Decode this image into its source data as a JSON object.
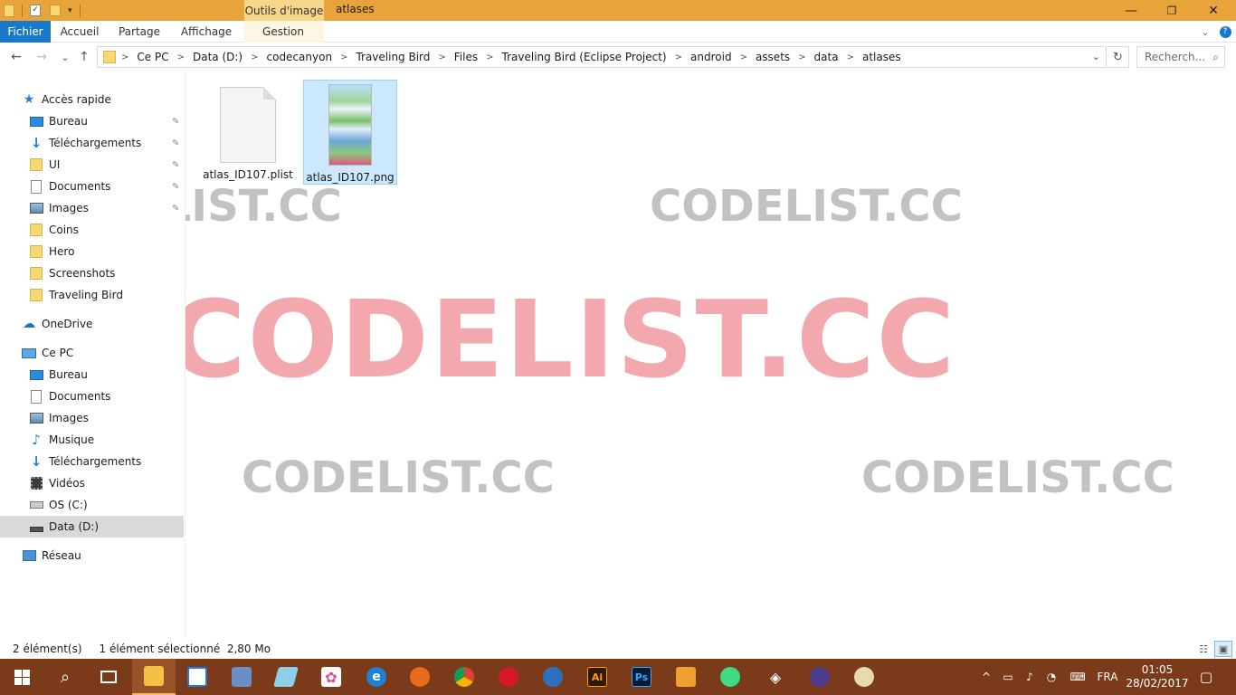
{
  "titlebar": {
    "context_tab": "Outils d'image",
    "title": "atlases",
    "minimize": "—",
    "restore": "❐",
    "close": "✕"
  },
  "ribbon": {
    "file": "Fichier",
    "home": "Accueil",
    "share": "Partage",
    "view": "Affichage",
    "manage": "Gestion"
  },
  "nav": {
    "back": "←",
    "forward": "→",
    "recent": "⌄",
    "up": "↑",
    "breadcrumb": [
      "Ce PC",
      "Data (D:)",
      "codecanyon",
      "Traveling Bird",
      "Files",
      "Traveling Bird (Eclipse Project)",
      "android",
      "assets",
      "data",
      "atlases"
    ],
    "search_placeholder": "Recherch...",
    "refresh": "↻"
  },
  "sidebar": {
    "quick_access": "Accès rapide",
    "quick_items": [
      {
        "label": "Bureau",
        "icon": "desktop-icon",
        "pinned": true
      },
      {
        "label": "Téléchargements",
        "icon": "download-icon",
        "pinned": true
      },
      {
        "label": "UI",
        "icon": "folder-icon",
        "pinned": true
      },
      {
        "label": "Documents",
        "icon": "documents-icon",
        "pinned": true
      },
      {
        "label": "Images",
        "icon": "images-icon",
        "pinned": true
      },
      {
        "label": "Coins",
        "icon": "folder-icon",
        "pinned": false
      },
      {
        "label": "Hero",
        "icon": "folder-icon",
        "pinned": false
      },
      {
        "label": "Screenshots",
        "icon": "folder-icon",
        "pinned": false
      },
      {
        "label": "Traveling Bird",
        "icon": "folder-icon",
        "pinned": false
      }
    ],
    "onedrive": "OneDrive",
    "this_pc": "Ce PC",
    "pc_items": [
      {
        "label": "Bureau",
        "icon": "desktop-icon"
      },
      {
        "label": "Documents",
        "icon": "documents-icon"
      },
      {
        "label": "Images",
        "icon": "images-icon"
      },
      {
        "label": "Musique",
        "icon": "music-icon"
      },
      {
        "label": "Téléchargements",
        "icon": "download-icon"
      },
      {
        "label": "Vidéos",
        "icon": "video-icon"
      },
      {
        "label": "OS (C:)",
        "icon": "drive-c-icon"
      },
      {
        "label": "Data (D:)",
        "icon": "drive-d-icon",
        "selected": true
      }
    ],
    "network": "Réseau"
  },
  "files": [
    {
      "name": "atlas_ID107.plist",
      "type": "document",
      "selected": false
    },
    {
      "name": "atlas_ID107.png",
      "type": "image",
      "selected": true
    }
  ],
  "watermark": "CODELIST.CC",
  "status": {
    "count": "2 élément(s)",
    "selection": "1 élément sélectionné  2,80 Mo"
  },
  "taskbar": {
    "apps": [
      "start-icon",
      "search-icon",
      "task-view-icon",
      "file-explorer-icon",
      "store-icon",
      "network-app-icon",
      "notes-icon",
      "photos-icon",
      "edge-icon",
      "firefox-icon",
      "chrome-icon",
      "opera-icon",
      "thunderbird-icon",
      "illustrator-icon",
      "photoshop-icon",
      "package-icon",
      "android-studio-icon",
      "unity-icon",
      "eclipse-icon",
      "paint-icon"
    ],
    "illustrator_label": "Ai",
    "photoshop_label": "Ps",
    "language": "FRA",
    "time": "01:05",
    "date": "28/02/2017"
  },
  "colors": {
    "titlebar": "#e8a33a",
    "file_tab": "#1979ca",
    "selection": "#cce8ff",
    "taskbar": "#7b3b1a"
  }
}
